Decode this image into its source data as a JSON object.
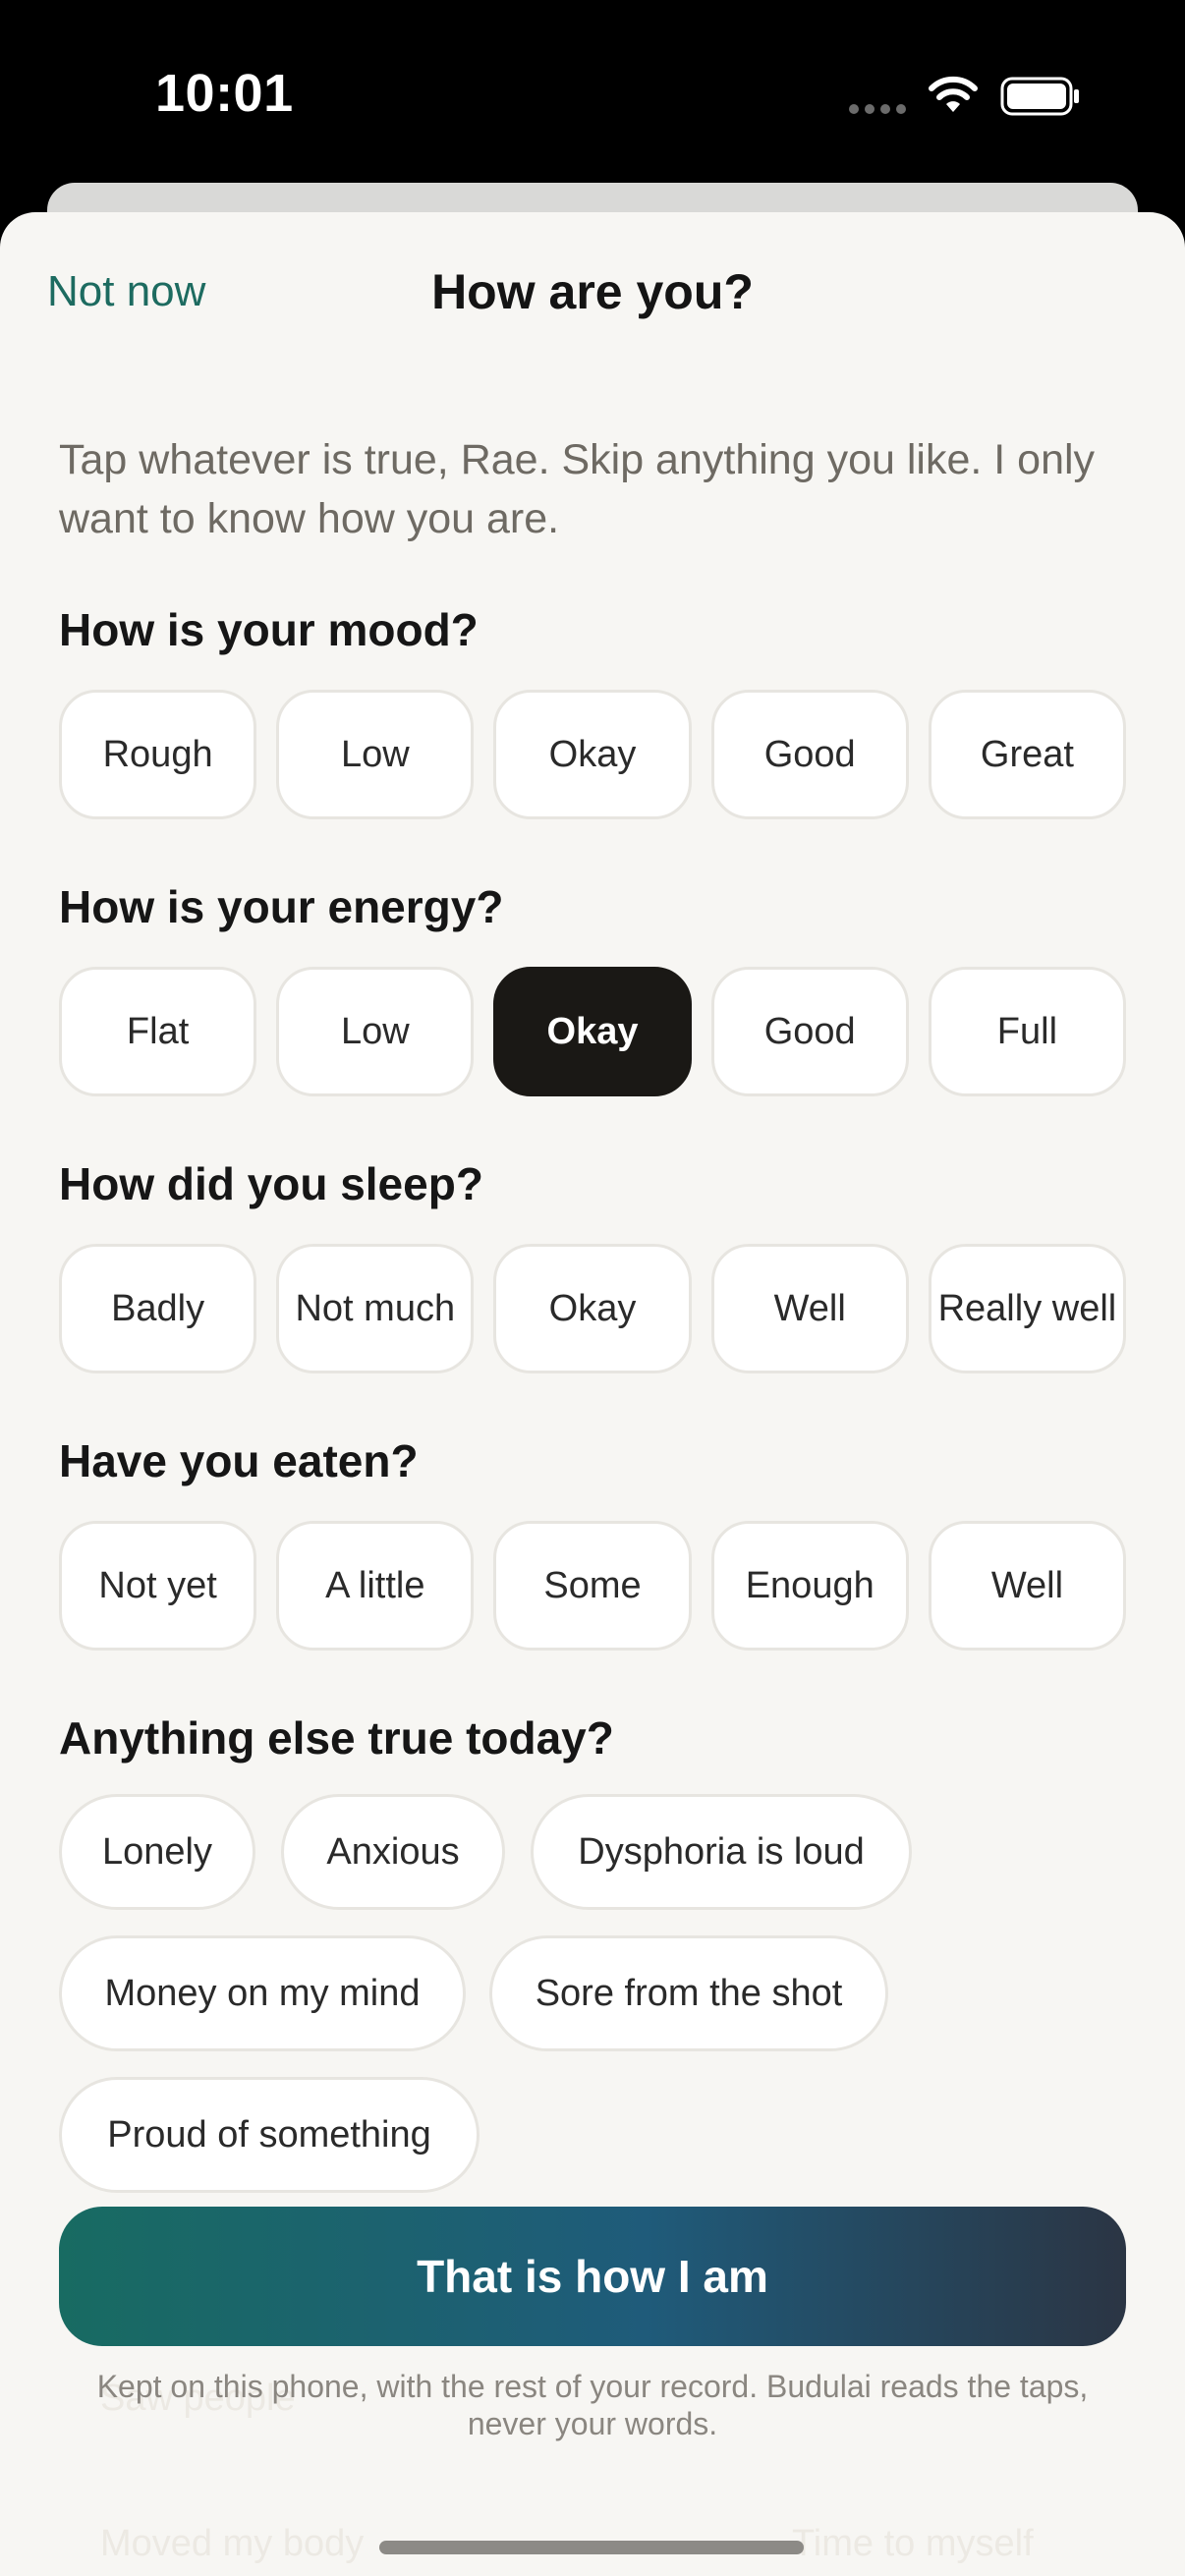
{
  "status_bar": {
    "time": "10:01"
  },
  "nav": {
    "cancel_label": "Not now",
    "title": "How are you?"
  },
  "intro": "Tap whatever is true, Rae. Skip anything you like. I only want to know how you are.",
  "mood": {
    "question": "How is your mood?",
    "options": [
      "Rough",
      "Low",
      "Okay",
      "Good",
      "Great"
    ],
    "selected": null
  },
  "energy": {
    "question": "How is your energy?",
    "options": [
      "Flat",
      "Low",
      "Okay",
      "Good",
      "Full"
    ],
    "selected": "Okay"
  },
  "sleep": {
    "question": "How did you sleep?",
    "options": [
      "Badly",
      "Not much",
      "Okay",
      "Well",
      "Really well"
    ],
    "selected": null
  },
  "eaten": {
    "question": "Have you eaten?",
    "options": [
      "Not yet",
      "A little",
      "Some",
      "Enough",
      "Well"
    ],
    "selected": null
  },
  "extras": {
    "question": "Anything else true today?",
    "chips": [
      "Lonely",
      "Anxious",
      "Dysphoria is loud",
      "Money on my mind",
      "Sore from the shot",
      "Proud of something"
    ],
    "hidden_chips": [
      "Saw people",
      "Moved my body",
      "Time to myself"
    ]
  },
  "primary_button": "That is how I am",
  "footnote": "Kept on this phone, with the rest of your record. Budulai reads the taps, never your words.",
  "colors": {
    "accent": "#1d6b60",
    "selected_fill": "#1a1815",
    "sheet_bg": "#f7f6f3",
    "button_gradient_start": "#186b62",
    "button_gradient_end": "#2b3544"
  },
  "icons": [
    "signal-icon",
    "wifi-icon",
    "battery-icon"
  ]
}
